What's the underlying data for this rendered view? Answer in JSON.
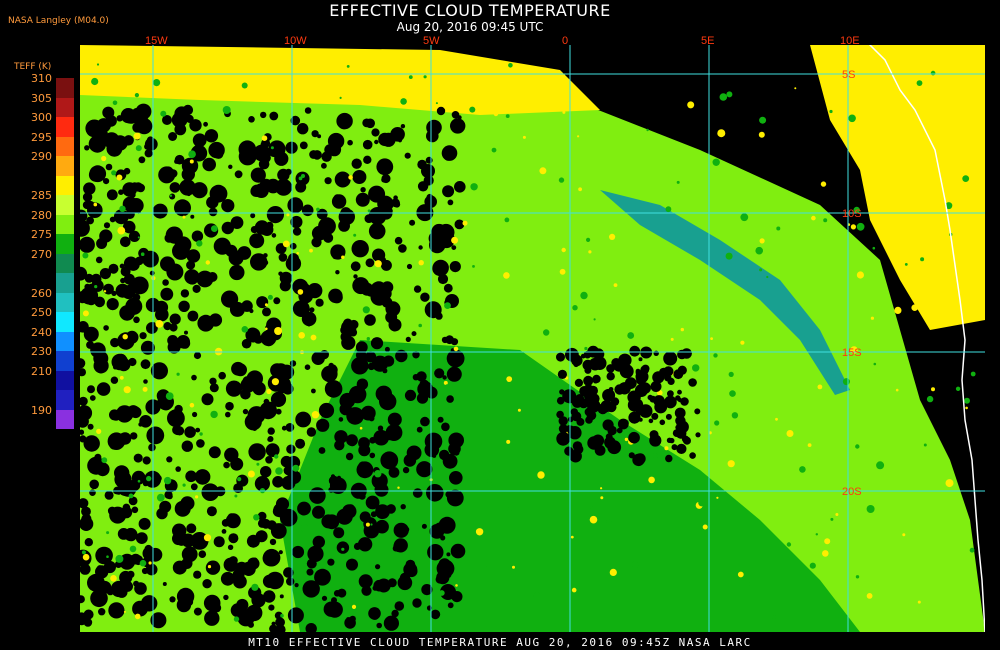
{
  "header": {
    "source": "NASA Langley (M04.0)",
    "title": "EFFECTIVE CLOUD TEMPERATURE",
    "subtitle": "Aug 20, 2016 09:45 UTC"
  },
  "footer": {
    "text": "MT10   EFFECTIVE CLOUD TEMPERATURE   AUG 20, 2016 09:45Z   NASA LARC"
  },
  "legend": {
    "title": "TEFF (K)",
    "entries": [
      {
        "label": "310",
        "color": "#7a1010"
      },
      {
        "label": "305",
        "color": "#b01818"
      },
      {
        "label": "300",
        "color": "#ff2a10"
      },
      {
        "label": "295",
        "color": "#ff6a10"
      },
      {
        "label": "290",
        "color": "#ffaa10"
      },
      {
        "label": "",
        "color": "#ffee00"
      },
      {
        "label": "285",
        "color": "#c8ff30"
      },
      {
        "label": "280",
        "color": "#80ee10"
      },
      {
        "label": "275",
        "color": "#10b010"
      },
      {
        "label": "270",
        "color": "#108a50"
      },
      {
        "label": "",
        "color": "#18a090"
      },
      {
        "label": "260",
        "color": "#20c0c0"
      },
      {
        "label": "250",
        "color": "#10e8ff"
      },
      {
        "label": "240",
        "color": "#1090ff"
      },
      {
        "label": "230",
        "color": "#1040d0"
      },
      {
        "label": "210",
        "color": "#1010a0"
      },
      {
        "label": "",
        "color": "#2020c0"
      },
      {
        "label": "190",
        "color": "#8a30e0"
      }
    ]
  },
  "grid": {
    "lon_labels": [
      "15W",
      "10W",
      "5W",
      "0",
      "5E",
      "10E"
    ],
    "lat_labels": [
      "5S",
      "10S",
      "15S",
      "20S"
    ],
    "line_color": "#3fe0e0",
    "label_color": "#ff3a10"
  },
  "colors": {
    "cloud_yellow": "#ffee00",
    "cloud_lightgreen": "#80ee10",
    "cloud_green": "#10b010",
    "cloud_teal": "#18a090",
    "coastline": "#ffffff",
    "background": "#000000"
  }
}
